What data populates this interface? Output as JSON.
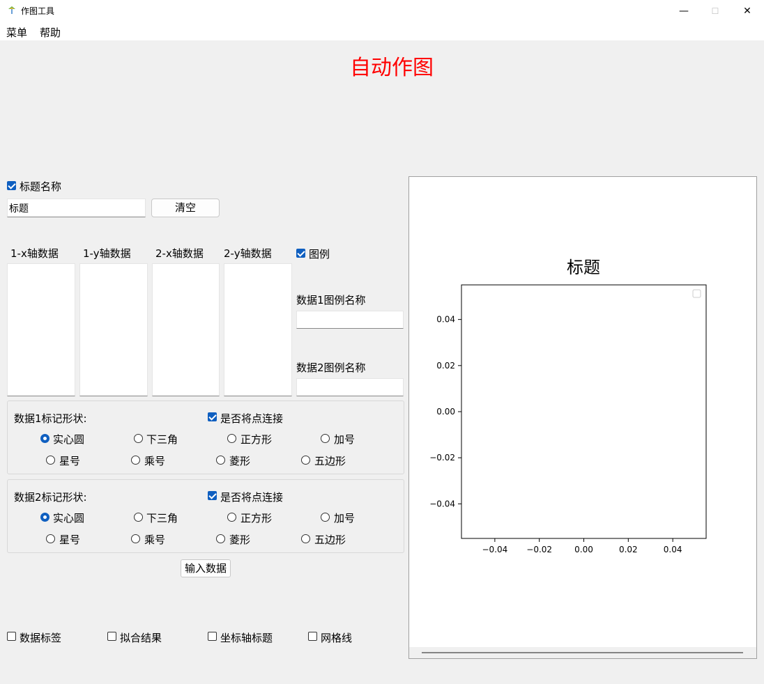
{
  "window": {
    "title": "作图工具",
    "minimize_glyph": "—",
    "maximize_glyph": "☐",
    "close_glyph": "✕"
  },
  "menu": {
    "items": [
      "菜单",
      "帮助"
    ]
  },
  "heading": "自动作图",
  "title_section": {
    "checkbox_label": "标题名称",
    "checked": true,
    "input_value": "标题",
    "clear_label": "清空"
  },
  "columns": [
    "1-x轴数据",
    "1-y轴数据",
    "2-x轴数据",
    "2-y轴数据"
  ],
  "legend": {
    "checkbox_label": "图例",
    "checked": true,
    "data1_label": "数据1图例名称",
    "data2_label": "数据2图例名称",
    "data1_value": "",
    "data2_value": ""
  },
  "marker_groups": [
    {
      "label": "数据1标记形状:",
      "connect_label": "是否将点连接",
      "connect_checked": true,
      "row1": [
        "实心圆",
        "下三角",
        "正方形",
        "加号"
      ],
      "row2": [
        "星号",
        "乘号",
        "菱形",
        "五边形"
      ],
      "selected": "实心圆"
    },
    {
      "label": "数据2标记形状:",
      "connect_label": "是否将点连接",
      "connect_checked": true,
      "row1": [
        "实心圆",
        "下三角",
        "正方形",
        "加号"
      ],
      "row2": [
        "星号",
        "乘号",
        "菱形",
        "五边形"
      ],
      "selected": "实心圆"
    }
  ],
  "input_button": "输入数据",
  "options": [
    {
      "label": "数据标签",
      "checked": false
    },
    {
      "label": "拟合结果",
      "checked": false
    },
    {
      "label": "坐标轴标题",
      "checked": false
    },
    {
      "label": "网格线",
      "checked": false
    }
  ],
  "chart_data": {
    "type": "scatter",
    "title": "标题",
    "xlabel": "",
    "ylabel": "",
    "series": [],
    "xlim": [
      -0.055,
      0.055
    ],
    "ylim": [
      -0.055,
      0.055
    ],
    "xticks": [
      "−0.04",
      "−0.02",
      "0.00",
      "0.02",
      "0.04"
    ],
    "xtick_values": [
      -0.04,
      -0.02,
      0.0,
      0.02,
      0.04
    ],
    "yticks": [
      "0.04",
      "0.02",
      "0.00",
      "−0.02",
      "−0.04"
    ],
    "ytick_values": [
      0.04,
      0.02,
      0.0,
      -0.02,
      -0.04
    ],
    "grid": false,
    "legend_position": "top-right"
  },
  "colors": {
    "heading": "#ff0000",
    "accent": "#0f5fc0"
  }
}
